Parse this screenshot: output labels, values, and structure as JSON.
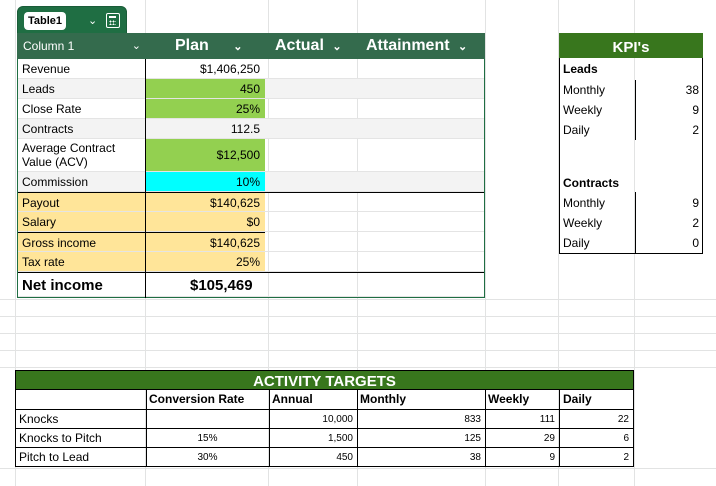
{
  "table": {
    "chip_name": "Table1",
    "headers": {
      "col1": "Column 1",
      "plan": "Plan",
      "actual": "Actual",
      "attainment": "Attainment"
    },
    "rows": [
      {
        "label": "Revenue",
        "plan": "$1,406,250"
      },
      {
        "label": "Leads",
        "plan": "450"
      },
      {
        "label": "Close Rate",
        "plan": "25%"
      },
      {
        "label": "Contracts",
        "plan": "112.5"
      },
      {
        "label": "Average Contract\nValue (ACV)",
        "plan": "$12,500"
      },
      {
        "label": "Commission",
        "plan": "10%"
      },
      {
        "label": "Payout",
        "plan": "$140,625"
      },
      {
        "label": "Salary",
        "plan": "$0"
      },
      {
        "label": "Gross income",
        "plan": "$140,625"
      },
      {
        "label": "Tax rate",
        "plan": "25%"
      },
      {
        "label": "Net income",
        "plan": "$105,469"
      }
    ]
  },
  "kpi": {
    "title": "KPI's",
    "leads": {
      "heading": "Leads",
      "rows": [
        {
          "label": "Monthly",
          "value": "38"
        },
        {
          "label": "Weekly",
          "value": "9"
        },
        {
          "label": "Daily",
          "value": "2"
        }
      ]
    },
    "contracts": {
      "heading": "Contracts",
      "rows": [
        {
          "label": "Monthly",
          "value": "9"
        },
        {
          "label": "Weekly",
          "value": "2"
        },
        {
          "label": "Daily",
          "value": "0"
        }
      ]
    }
  },
  "activity": {
    "title": "ACTIVITY TARGETS",
    "headers": [
      "Conversion Rate",
      "Annual",
      "Monthly",
      "Weekly",
      "Daily"
    ],
    "rows": [
      {
        "label": "Knocks",
        "conv": "",
        "annual": "10,000",
        "monthly": "833",
        "weekly": "111",
        "daily": "22"
      },
      {
        "label": "Knocks to Pitch",
        "conv": "15%",
        "annual": "1,500",
        "monthly": "125",
        "weekly": "29",
        "daily": "6"
      },
      {
        "label": "Pitch to Lead",
        "conv": "30%",
        "annual": "450",
        "monthly": "38",
        "weekly": "9",
        "daily": "2"
      }
    ]
  },
  "colors": {
    "table_header": "#346b4d",
    "kpi_header": "#38761d",
    "input_green": "#93d050",
    "cyan": "#00ffff",
    "payout_yellow": "#ffe599"
  }
}
